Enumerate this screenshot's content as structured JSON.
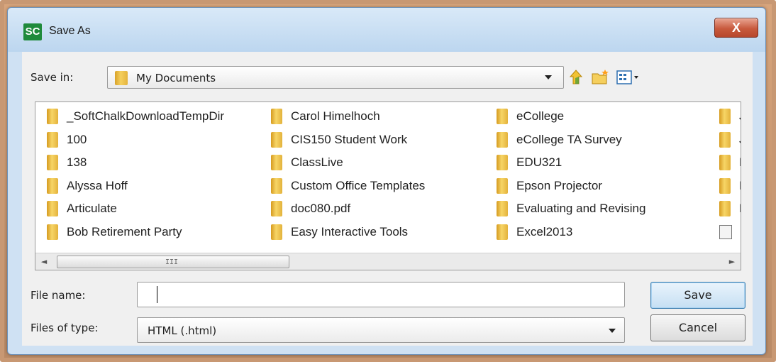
{
  "window": {
    "title": "Save As",
    "logo_text": "SC",
    "close_glyph": "X"
  },
  "save_in": {
    "label": "Save in:",
    "value": "My Documents"
  },
  "toolbar_icons": [
    "up-one-level-icon",
    "new-folder-icon",
    "view-menu-icon"
  ],
  "file_list": {
    "columns": [
      [
        {
          "name": "_SoftChalkDownloadTempDir",
          "type": "folder"
        },
        {
          "name": "100",
          "type": "folder"
        },
        {
          "name": "138",
          "type": "folder"
        },
        {
          "name": "Alyssa Hoff",
          "type": "folder"
        },
        {
          "name": "Articulate",
          "type": "folder"
        },
        {
          "name": "Bob Retirement Party",
          "type": "folder"
        }
      ],
      [
        {
          "name": "Carol Himelhoch",
          "type": "folder"
        },
        {
          "name": "CIS150 Student Work",
          "type": "folder"
        },
        {
          "name": "ClassLive",
          "type": "folder"
        },
        {
          "name": "Custom Office Templates",
          "type": "folder"
        },
        {
          "name": "doc080.pdf",
          "type": "folder"
        },
        {
          "name": "Easy Interactive Tools",
          "type": "folder"
        }
      ],
      [
        {
          "name": "eCollege",
          "type": "folder"
        },
        {
          "name": "eCollege TA Survey",
          "type": "folder"
        },
        {
          "name": "EDU321",
          "type": "folder"
        },
        {
          "name": "Epson Projector",
          "type": "folder"
        },
        {
          "name": "Evaluating and Revising",
          "type": "folder"
        },
        {
          "name": "Excel2013",
          "type": "folder"
        }
      ],
      [
        {
          "name": "Je",
          "type": "folder"
        },
        {
          "name": "Jo",
          "type": "folder"
        },
        {
          "name": "La",
          "type": "folder"
        },
        {
          "name": "Me",
          "type": "folder"
        },
        {
          "name": "MT",
          "type": "folder"
        },
        {
          "name": "My",
          "type": "file"
        }
      ]
    ],
    "scroll_left": "◄",
    "scroll_right": "►",
    "thumb_grip": "III"
  },
  "file_name": {
    "label": "File name:",
    "value": ""
  },
  "files_of_type": {
    "label": "Files of type:",
    "value": "HTML (.html)"
  },
  "buttons": {
    "save": "Save",
    "cancel": "Cancel"
  },
  "colors": {
    "accent": "#3c7fb1",
    "close": "#c85a3d",
    "folder": "#f5cf5d"
  }
}
